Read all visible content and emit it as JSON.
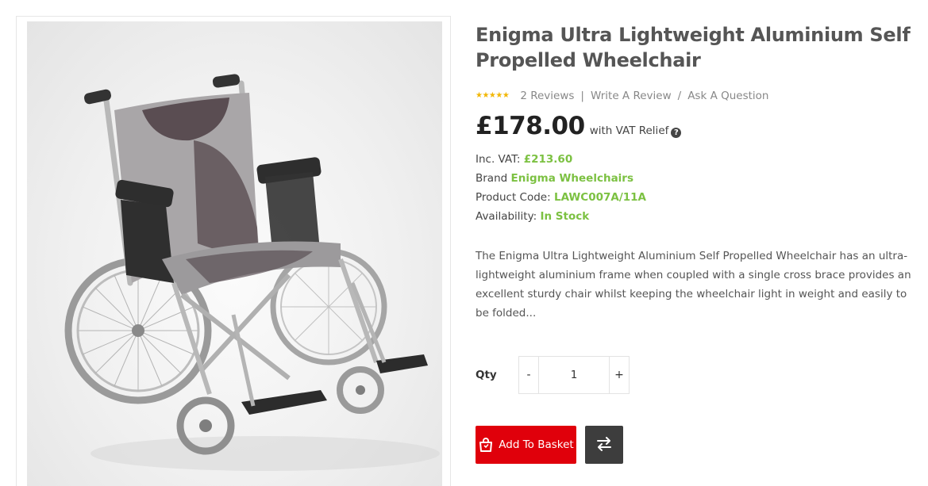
{
  "product": {
    "title": "Enigma Ultra Lightweight Aluminium Self Propelled Wheelchair",
    "image_alt": "Enigma Ultra Lightweight Aluminium Self Propelled Wheelchair",
    "rating": {
      "stars": "★★★★★",
      "stars_value": 5,
      "stars_max": 5,
      "reviews_label": "2 Reviews",
      "write_review_label": "Write A Review",
      "ask_question_label": "Ask A Question",
      "separator_1": "|",
      "separator_2": "/"
    },
    "price": "£178.00",
    "price_note": "with VAT Relief",
    "help_glyph": "?",
    "inc_vat_label": "Inc. VAT:",
    "inc_vat_value": "£213.60",
    "brand_label": "Brand",
    "brand_value": "Enigma Wheelchairs",
    "code_label": "Product Code:",
    "code_value": "LAWC007A/11A",
    "availability_label": "Availability:",
    "availability_value": "In Stock",
    "description": "The Enigma Ultra Lightweight Aluminium Self Propelled Wheelchair has an ultra-lightweight aluminium frame when coupled with a single cross brace provides an excellent sturdy chair whilst keeping the wheelchair light in weight and easily to be folded..."
  },
  "quantity": {
    "label": "Qty",
    "minus_label": "-",
    "plus_label": "+",
    "value": "1"
  },
  "actions": {
    "add_label": "Add To Basket",
    "add_icon": "basket-icon",
    "compare_icon": "compare-arrows-icon"
  },
  "colors": {
    "accent_red": "#e0000b",
    "accent_green": "#7cc142",
    "star": "#f2b705",
    "dark_button": "#3d3d3d"
  }
}
